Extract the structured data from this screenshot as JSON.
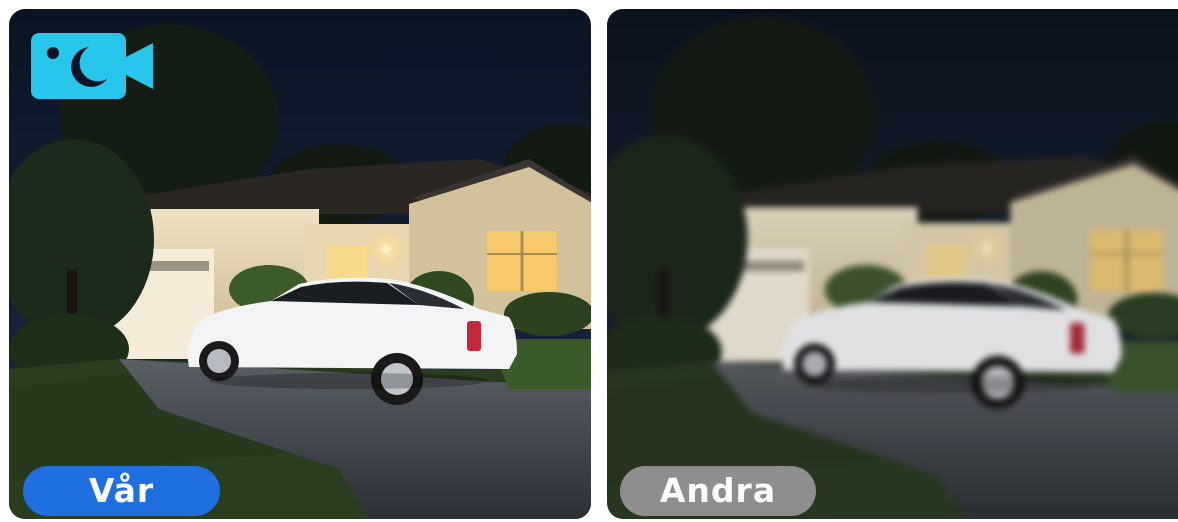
{
  "comparison": {
    "left": {
      "label": "Vår",
      "label_color": "#1f6fe0"
    },
    "right": {
      "label": "Andra",
      "label_color": "#8e8e8e"
    }
  },
  "badge": {
    "icon": "night-vision-camera-icon",
    "color": "#29c6ec"
  },
  "scene": {
    "description_icon": "house-with-car-at-night"
  }
}
